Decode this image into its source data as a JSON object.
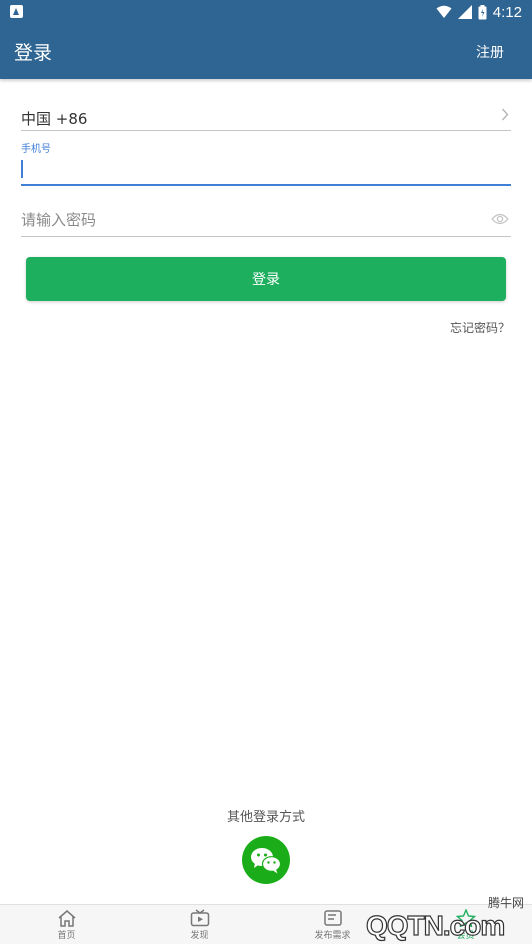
{
  "status_bar": {
    "time": "4:12"
  },
  "app_bar": {
    "title": "登录",
    "register_label": "注册"
  },
  "form": {
    "country_code": "中国 +86",
    "phone_label": "手机号",
    "phone_value": "",
    "password_placeholder": "请输入密码",
    "login_label": "登录",
    "forgot_label": "忘记密码？"
  },
  "other_login": {
    "title": "其他登录方式",
    "icon": "wechat-icon"
  },
  "tabs": [
    {
      "label": "首页",
      "icon": "home-icon"
    },
    {
      "label": "发现",
      "icon": "tv-icon"
    },
    {
      "label": "发布需求",
      "icon": "publish-icon"
    },
    {
      "label": "会员",
      "icon": "member-icon",
      "active": true
    }
  ],
  "watermark": {
    "text": "腾牛网",
    "logo": "QQTN.com"
  },
  "colors": {
    "primary": "#2f6592",
    "accent_green": "#1daf5e",
    "focus_blue": "#3f7fd6",
    "wechat_green": "#1aad19"
  }
}
